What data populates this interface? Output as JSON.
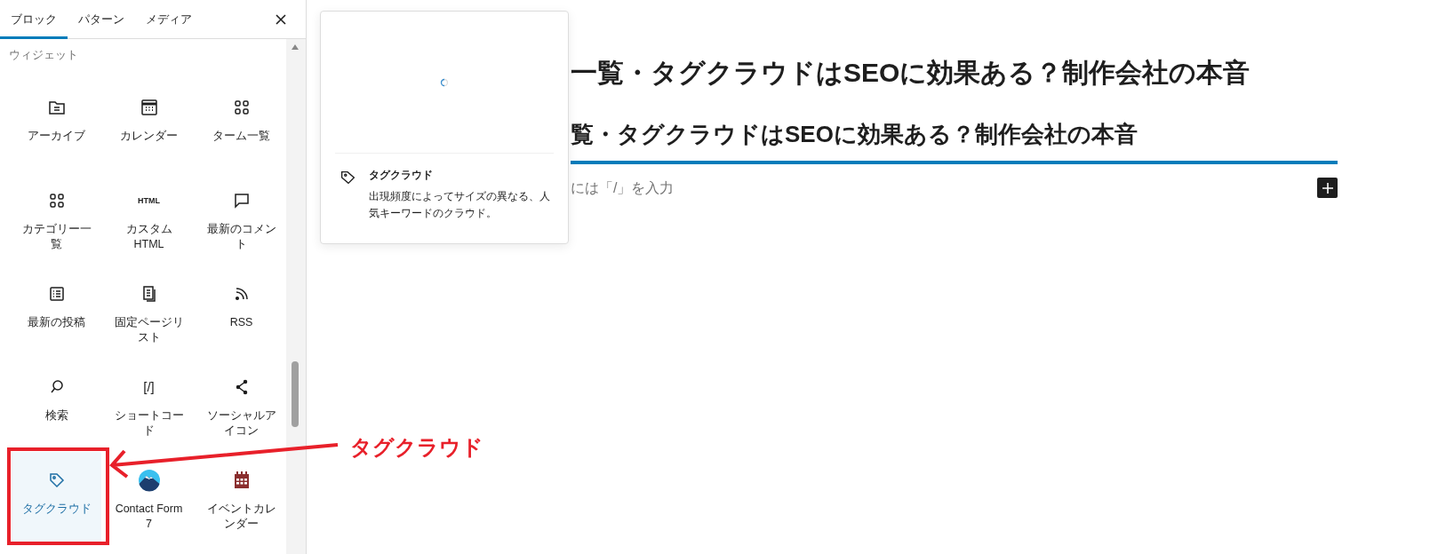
{
  "tabs": [
    {
      "label": "ブロック",
      "selected": true
    },
    {
      "label": "パターン",
      "selected": false
    },
    {
      "label": "メディア",
      "selected": false
    }
  ],
  "section_title": "ウィジェット",
  "blocks": [
    {
      "label": "アーカイブ",
      "selected": false
    },
    {
      "label": "カレンダー",
      "selected": false
    },
    {
      "label": "ターム一覧",
      "selected": false
    },
    {
      "label": "カテゴリー一覧",
      "selected": false
    },
    {
      "label": "カスタム HTML",
      "icon_text": "HTML",
      "selected": false
    },
    {
      "label": "最新のコメント",
      "selected": false
    },
    {
      "label": "最新の投稿",
      "selected": false
    },
    {
      "label": "固定ページリスト",
      "selected": false
    },
    {
      "label": "RSS",
      "selected": false
    },
    {
      "label": "検索",
      "selected": false
    },
    {
      "label": "ショートコード",
      "icon_text": "[/]",
      "selected": false
    },
    {
      "label": "ソーシャルアイコン",
      "selected": false
    },
    {
      "label": "タグクラウド",
      "selected": true
    },
    {
      "label": "Contact Form 7",
      "selected": false
    },
    {
      "label": "イベントカレンダー",
      "selected": false
    }
  ],
  "preview": {
    "title": "タグクラウド",
    "description": "出現頻度によってサイズの異なる、人気キーワードのクラウド。"
  },
  "editor": {
    "headings": [
      "一覧・タグクラウドはSEOに効果ある？制作会社の本音",
      "覧・タグクラウドはSEOに効果ある？制作会社の本音"
    ],
    "placeholder": "には「/」を入力"
  },
  "annotation": {
    "label": "タグクラウド"
  }
}
